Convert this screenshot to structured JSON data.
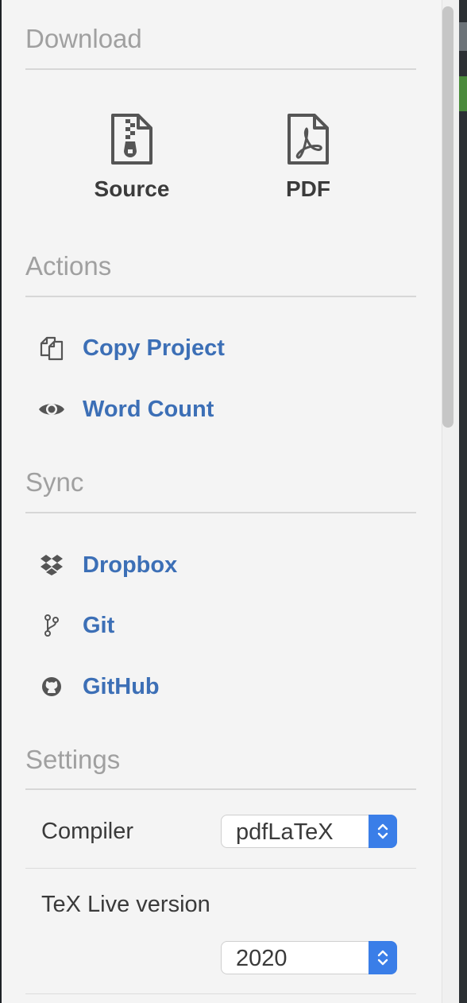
{
  "download": {
    "title": "Download",
    "source_label": "Source",
    "pdf_label": "PDF"
  },
  "actions": {
    "title": "Actions",
    "items": [
      {
        "label": "Copy Project",
        "icon": "copy-icon"
      },
      {
        "label": "Word Count",
        "icon": "eye-icon"
      }
    ]
  },
  "sync": {
    "title": "Sync",
    "items": [
      {
        "label": "Dropbox",
        "icon": "dropbox-icon"
      },
      {
        "label": "Git",
        "icon": "git-branch-icon"
      },
      {
        "label": "GitHub",
        "icon": "github-icon"
      }
    ]
  },
  "settings": {
    "title": "Settings",
    "compiler_label": "Compiler",
    "compiler_value": "pdfLaTeX",
    "texlive_label": "TeX Live version",
    "texlive_value": "2020"
  },
  "colors": {
    "link": "#3c6fb6",
    "section_title": "#a0a0a0",
    "stepper": "#3a7ee8"
  }
}
